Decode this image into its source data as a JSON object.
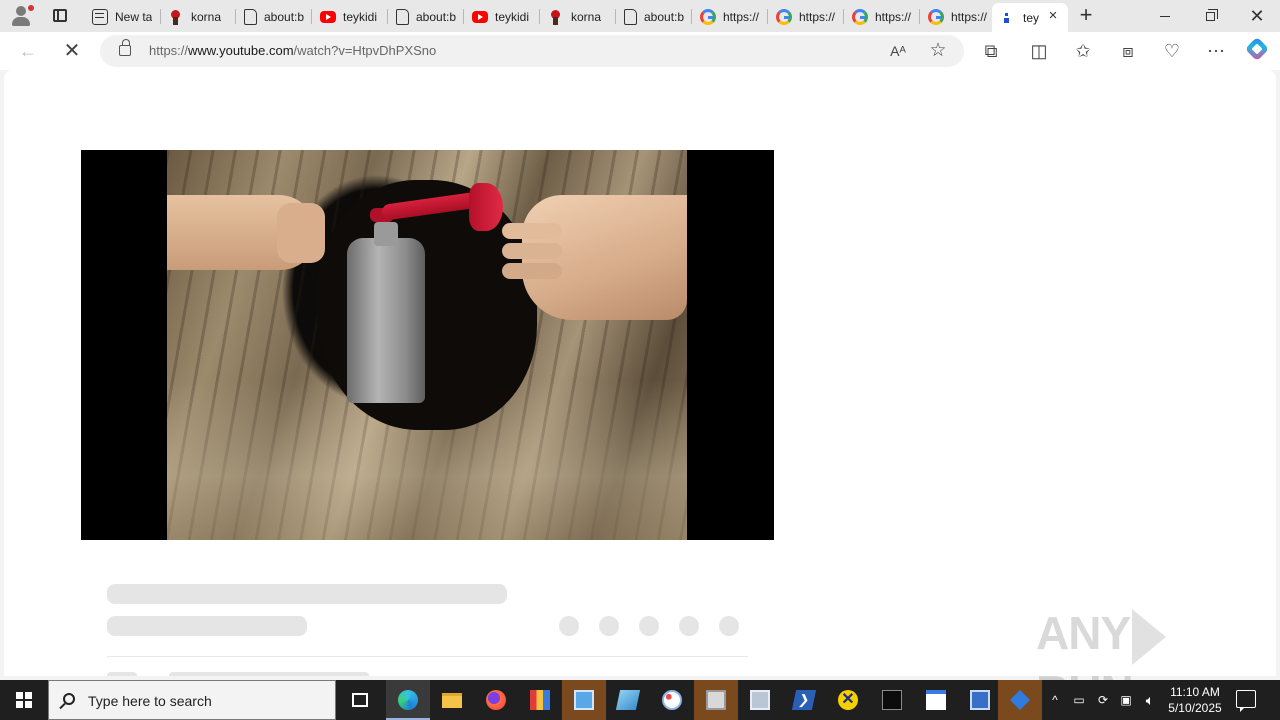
{
  "browser": {
    "tabs": [
      {
        "title": "New ta",
        "icon": "newtab-icon"
      },
      {
        "title": "korna",
        "icon": "korn-icon"
      },
      {
        "title": "about:b",
        "icon": "document-icon"
      },
      {
        "title": "teykidi",
        "icon": "youtube-icon"
      },
      {
        "title": "about:b",
        "icon": "document-icon"
      },
      {
        "title": "teykidi",
        "icon": "youtube-icon"
      },
      {
        "title": "korna",
        "icon": "korn-icon"
      },
      {
        "title": "about:b",
        "icon": "document-icon"
      },
      {
        "title": "https://",
        "icon": "google-icon"
      },
      {
        "title": "https://",
        "icon": "google-icon"
      },
      {
        "title": "https://",
        "icon": "google-icon"
      },
      {
        "title": "https://",
        "icon": "google-icon"
      },
      {
        "title": "tey",
        "icon": "page-icon",
        "active": true
      }
    ],
    "new_tab_symbol": "+",
    "close_tab_symbol": "×",
    "address": {
      "prefix": "https://",
      "host": "www.youtube.com",
      "path": "/watch?v=HtpvDhPXSno"
    }
  },
  "page": {
    "player_state": "loading",
    "skeleton_action_count": 5
  },
  "watermark": {
    "left": "ANY",
    "right": "RUN"
  },
  "taskbar": {
    "search_placeholder": "Type here to search",
    "time": "11:10 AM",
    "date": "5/10/2025"
  },
  "colors": {
    "accent_blue": "#1a73e8",
    "youtube_red": "#ff0000",
    "taskbar": "#1f1f1f",
    "highlight_orange": "#7a4a1e"
  }
}
